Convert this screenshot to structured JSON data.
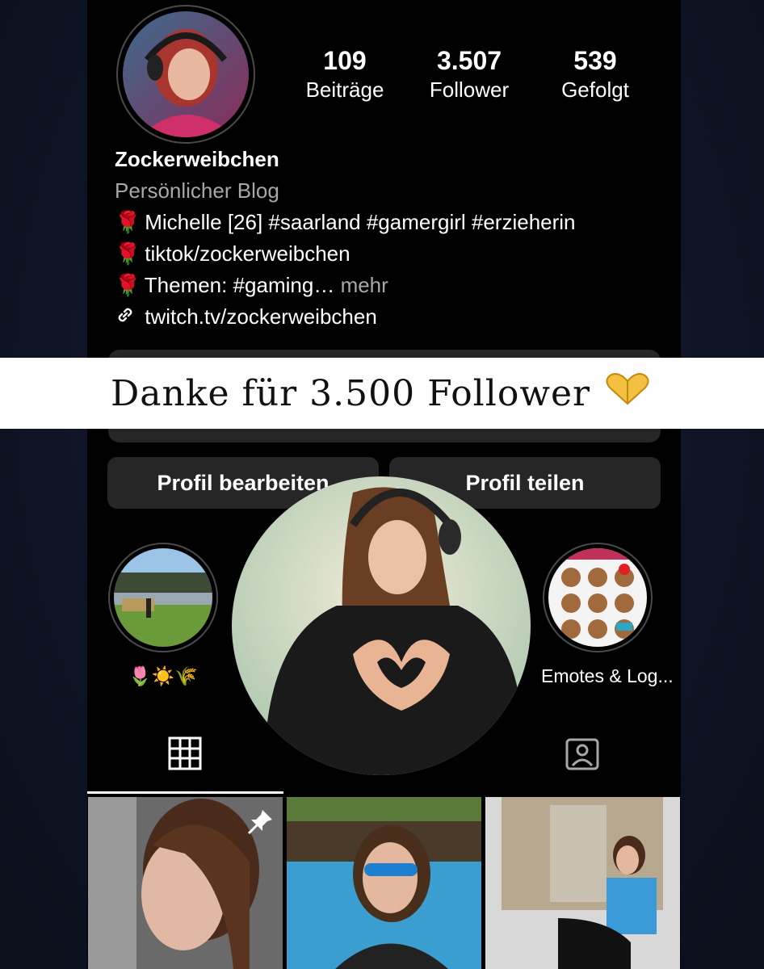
{
  "profile": {
    "username": "Zockerweibchen",
    "category": "Persönlicher Blog",
    "stats": [
      {
        "value": "109",
        "label": "Beiträge"
      },
      {
        "value": "3.507",
        "label": "Follower"
      },
      {
        "value": "539",
        "label": "Gefolgt"
      }
    ],
    "bio_lines": [
      "Michelle [26] #saarland #gamergirl #erzieherin",
      "tiktok/zockerweibchen",
      "Themen: #gaming…"
    ],
    "bio_more": "mehr",
    "link": "twitch.tv/zockerweibchen"
  },
  "buttons": {
    "edit_profile": "Profil bearbeiten",
    "share_profile": "Profil teilen"
  },
  "highlights": [
    {
      "label": "🌷☀️🌾"
    },
    {
      "label": "Emotes & Log..."
    }
  ],
  "banner": {
    "text": "Danke für 3.500 Follower"
  },
  "icons": {
    "rose": "rose-icon",
    "link": "link-icon",
    "grid": "grid-icon",
    "tagged": "tagged-icon",
    "pin": "pin-icon",
    "heart_hands": "heart-hands-icon"
  }
}
